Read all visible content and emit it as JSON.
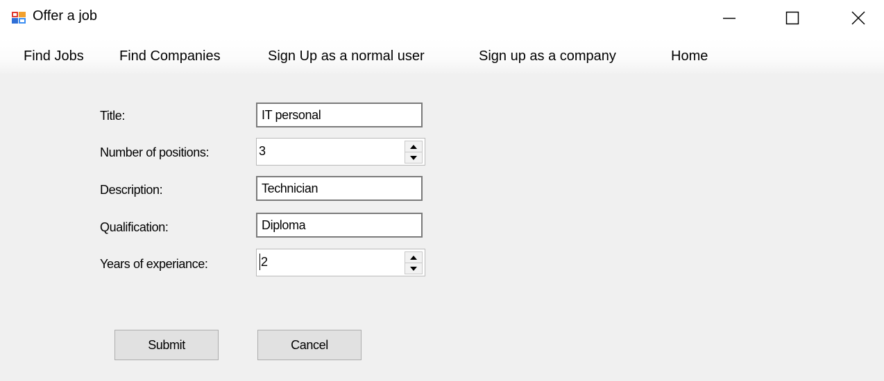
{
  "window": {
    "title": "Offer a job"
  },
  "menu": {
    "items": [
      {
        "label": "Find Jobs"
      },
      {
        "label": "Find Companies"
      },
      {
        "label": "Sign Up as a normal user"
      },
      {
        "label": "Sign up as a company"
      },
      {
        "label": "Home"
      }
    ]
  },
  "form": {
    "title_label": "Title:",
    "title_value": "IT personal",
    "positions_label": "Number of positions:",
    "positions_value": "3",
    "description_label": "Description:",
    "description_value": "Technician",
    "qualification_label": "Qualification:",
    "qualification_value": "Diploma",
    "experience_label": "Years of experiance:",
    "experience_value": "2"
  },
  "buttons": {
    "submit_label": "Submit",
    "cancel_label": "Cancel"
  },
  "icons": {
    "app": "app-form-icon",
    "minimize": "minimize-icon",
    "maximize": "maximize-icon",
    "close": "close-icon",
    "spin_up": "arrow-up-icon",
    "spin_down": "arrow-down-icon"
  },
  "colors": {
    "window_background": "#f0f0f0",
    "titlebar_background": "#ffffff",
    "button_background": "#e1e1e1"
  }
}
